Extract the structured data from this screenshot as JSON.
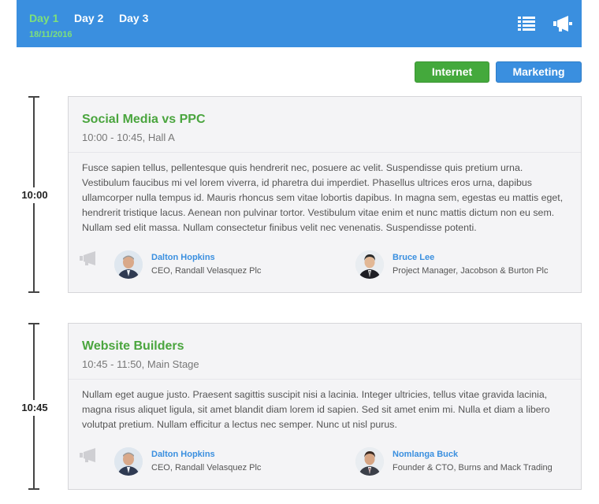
{
  "header": {
    "tabs": [
      {
        "label": "Day 1",
        "active": true
      },
      {
        "label": "Day 2",
        "active": false
      },
      {
        "label": "Day 3",
        "active": false
      }
    ],
    "date": "18/11/2016",
    "icons": [
      "list-icon",
      "megaphone-icon"
    ],
    "colors": {
      "bar": "#3a8fdf",
      "active_tab": "#7ee07a"
    }
  },
  "filters": [
    {
      "label": "Internet",
      "color": "#44a93c"
    },
    {
      "label": "Marketing",
      "color": "#3a8fdf"
    }
  ],
  "sessions": [
    {
      "time": "10:00",
      "title": "Social Media vs PPC",
      "meta": "10:00 - 10:45, Hall A",
      "description": "Fusce sapien tellus, pellentesque quis hendrerit nec, posuere ac velit. Suspendisse quis pretium urna. Vestibulum faucibus mi vel lorem viverra, id pharetra dui imperdiet. Phasellus ultrices eros urna, dapibus ullamcorper nulla tempus id. Mauris rhoncus sem vitae lobortis dapibus. In magna sem, egestas eu mattis eget, hendrerit tristique lacus. Aenean non pulvinar tortor. Vestibulum vitae enim et nunc mattis dictum non eu sem. Nullam sed elit massa. Nullam consectetur finibus velit nec venenatis. Suspendisse potenti.",
      "speakers": [
        {
          "name": "Dalton Hopkins",
          "role": "CEO, Randall Velasquez Plc"
        },
        {
          "name": "Bruce Lee",
          "role": "Project Manager, Jacobson & Burton Plc"
        }
      ]
    },
    {
      "time": "10:45",
      "title": "Website Builders",
      "meta": "10:45 - 11:50, Main Stage",
      "description": "Nullam eget augue justo. Praesent sagittis suscipit nisi a lacinia. Integer ultricies, tellus vitae gravida lacinia, magna risus aliquet ligula, sit amet blandit diam lorem id sapien. Sed sit amet enim mi. Nulla et diam a libero volutpat pretium. Nullam efficitur a lectus nec semper. Nunc ut nisl purus.",
      "speakers": [
        {
          "name": "Dalton Hopkins",
          "role": "CEO, Randall Velasquez Plc"
        },
        {
          "name": "Nomlanga Buck",
          "role": "Founder & CTO, Burns and Mack Trading"
        }
      ]
    }
  ]
}
